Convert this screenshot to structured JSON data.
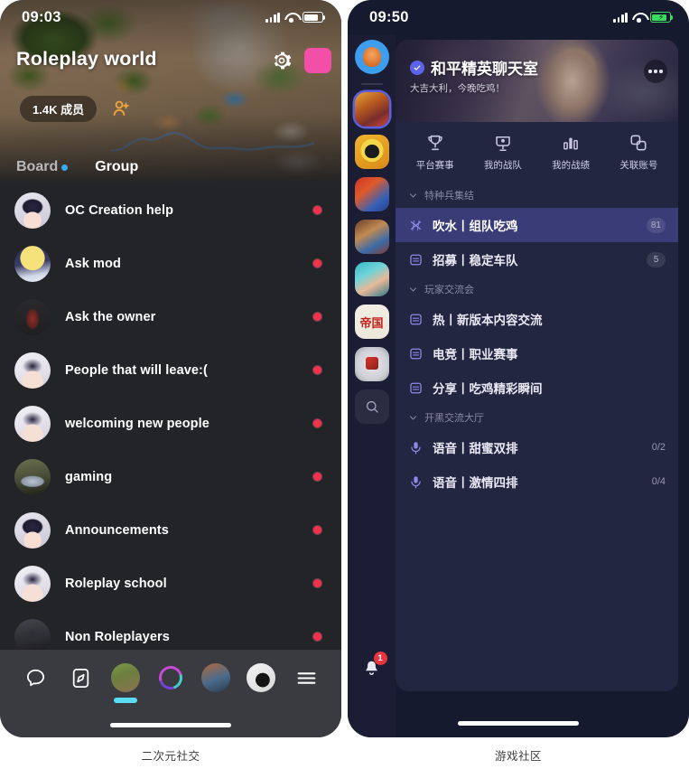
{
  "left_phone": {
    "caption": "二次元社交",
    "status_bar": {
      "time": "09:03",
      "signal_icon": "signal-bars-icon",
      "wifi_icon": "wifi-icon",
      "battery_icon": "battery-icon"
    },
    "hero": {
      "title": "Roleplay world",
      "settings_icon": "gear-icon",
      "color_swatch": "#f24fa8",
      "members_label": "1.4K 成员",
      "add_member_icon": "add-person-icon"
    },
    "tabs": [
      {
        "label": "Board",
        "active": false,
        "has_dot": true,
        "dot_color": "#39a9f0"
      },
      {
        "label": "Group",
        "active": true,
        "has_dot": false
      }
    ],
    "channels": [
      {
        "name": "OC Creation help",
        "avatar": "av-anime1",
        "unread": true
      },
      {
        "name": "Ask mod",
        "avatar": "av-anime2",
        "unread": true
      },
      {
        "name": "Ask the owner",
        "avatar": "av-armor",
        "unread": true
      },
      {
        "name": "People that will leave:(",
        "avatar": "av-anime3",
        "unread": true
      },
      {
        "name": "welcoming new people",
        "avatar": "av-anime3",
        "unread": true
      },
      {
        "name": "gaming",
        "avatar": "av-car",
        "unread": true
      },
      {
        "name": "Announcements",
        "avatar": "av-anime1",
        "unread": true
      },
      {
        "name": "Roleplay school",
        "avatar": "av-anime3",
        "unread": true
      },
      {
        "name": "Non Roleplayers",
        "avatar": "av-dark",
        "unread": true
      }
    ],
    "bottom_nav": [
      {
        "name": "chat-icon",
        "type": "icon"
      },
      {
        "name": "compass-icon",
        "type": "icon"
      },
      {
        "name": "world-avatar",
        "type": "avatar",
        "active": true
      },
      {
        "name": "ring-icon",
        "type": "ring"
      },
      {
        "name": "photo-avatar",
        "type": "avatar"
      },
      {
        "name": "cat-avatar",
        "type": "avatar"
      },
      {
        "name": "menu-icon",
        "type": "icon"
      }
    ]
  },
  "right_phone": {
    "caption": "游戏社区",
    "status_bar": {
      "time": "09:50",
      "signal_icon": "signal-bars-icon",
      "wifi_icon": "wifi-icon",
      "battery_icon": "battery-charging-icon"
    },
    "server_rail": {
      "home_icon": "home-server-avatar",
      "servers": [
        {
          "name": "server-1",
          "art": "ra1",
          "selected": true
        },
        {
          "name": "server-2",
          "art": "ra2",
          "selected": false
        },
        {
          "name": "server-3",
          "art": "ra3",
          "selected": false
        },
        {
          "name": "server-4",
          "art": "ra4",
          "selected": false
        },
        {
          "name": "server-5",
          "art": "ra5",
          "selected": false
        },
        {
          "name": "server-6",
          "art": "ra6",
          "selected": false
        },
        {
          "name": "server-7",
          "art": "ra7",
          "selected": false
        }
      ],
      "search_icon": "search-icon",
      "notification": {
        "icon": "bell-icon",
        "badge": "1"
      }
    },
    "banner": {
      "title": "和平精英聊天室",
      "verified_icon": "verified-badge-icon",
      "subtitle": "大吉大利，今晚吃鸡！",
      "more_icon": "more-options-icon"
    },
    "quick_actions": [
      {
        "label": "平台赛事",
        "icon": "trophy-icon"
      },
      {
        "label": "我的战队",
        "icon": "team-shield-icon"
      },
      {
        "label": "我的战绩",
        "icon": "bar-chart-icon"
      },
      {
        "label": "关联账号",
        "icon": "link-accounts-icon"
      }
    ],
    "groups": [
      {
        "title": "特种兵集结",
        "channels": [
          {
            "name": "吹水丨组队吃鸡",
            "icon": "hashtag-icon",
            "badge": "81",
            "active": true
          },
          {
            "name": "招募丨稳定车队",
            "icon": "text-channel-icon",
            "badge": "5",
            "active": false
          }
        ]
      },
      {
        "title": "玩家交流会",
        "channels": [
          {
            "name": "热丨新版本内容交流",
            "icon": "text-channel-icon",
            "badge": "",
            "active": false
          },
          {
            "name": "电竞丨职业赛事",
            "icon": "text-channel-icon",
            "badge": "",
            "active": false
          },
          {
            "name": "分享丨吃鸡精彩瞬间",
            "icon": "text-channel-icon",
            "badge": "",
            "active": false
          }
        ]
      },
      {
        "title": "开黑交流大厅",
        "channels": [
          {
            "name": "语音丨甜蜜双排",
            "icon": "voice-channel-icon",
            "count": "0/2",
            "active": false
          },
          {
            "name": "语音丨激情四排",
            "icon": "voice-channel-icon",
            "count": "0/4",
            "active": false
          }
        ]
      }
    ]
  }
}
